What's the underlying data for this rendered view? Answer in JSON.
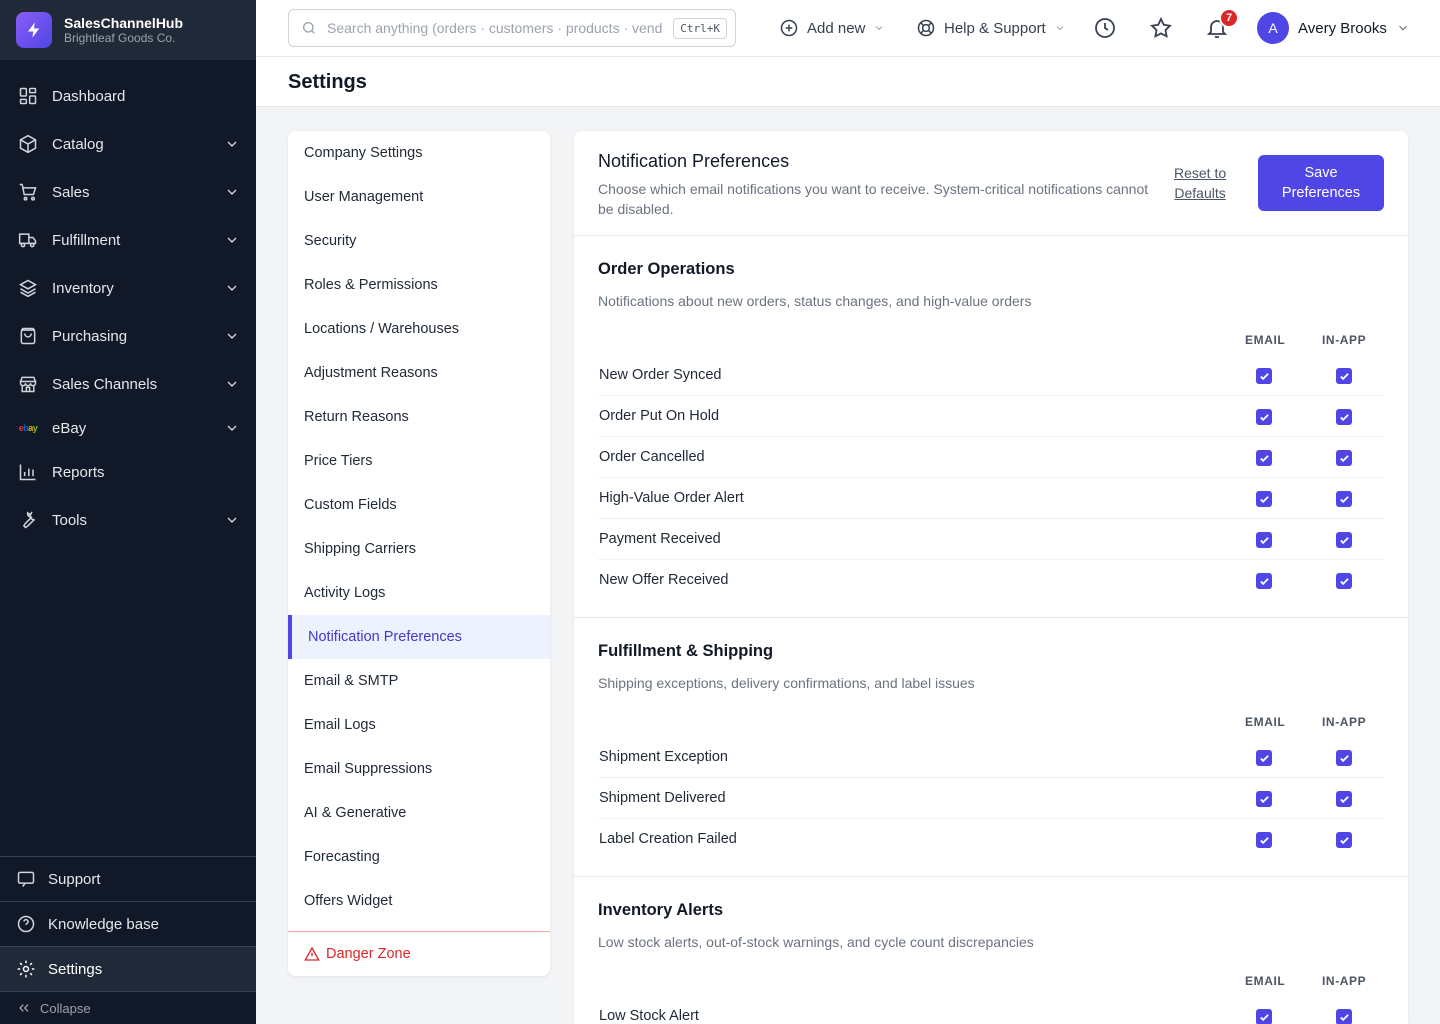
{
  "brand": {
    "name": "SalesChannelHub",
    "org": "Brightleaf Goods Co."
  },
  "nav": {
    "items": [
      {
        "label": "Dashboard",
        "icon": "dashboard-icon"
      },
      {
        "label": "Catalog",
        "icon": "box-icon"
      },
      {
        "label": "Sales",
        "icon": "cart-icon"
      },
      {
        "label": "Fulfillment",
        "icon": "truck-icon"
      },
      {
        "label": "Inventory",
        "icon": "layers-icon"
      },
      {
        "label": "Purchasing",
        "icon": "bag-icon"
      },
      {
        "label": "Sales Channels",
        "icon": "store-icon"
      },
      {
        "label": "eBay",
        "icon": "ebay-logo-icon"
      },
      {
        "label": "Reports",
        "icon": "bar-chart-icon"
      },
      {
        "label": "Tools",
        "icon": "wrench-icon"
      }
    ],
    "bottom": {
      "support": "Support",
      "knowledge": "Knowledge base",
      "settings": "Settings",
      "collapse": "Collapse"
    }
  },
  "topbar": {
    "search_placeholder": "Search anything (orders · customers · products · vendors)",
    "search_shortcut": "Ctrl+K",
    "add_new": "Add new",
    "help": "Help & Support",
    "notification_count": "7",
    "user_initial": "A",
    "user_name": "Avery Brooks"
  },
  "page": {
    "title": "Settings"
  },
  "settings_menu": {
    "items": [
      "Company Settings",
      "User Management",
      "Security",
      "Roles & Permissions",
      "Locations / Warehouses",
      "Adjustment Reasons",
      "Return Reasons",
      "Price Tiers",
      "Custom Fields",
      "Shipping Carriers",
      "Activity Logs",
      "Notification Preferences",
      "Email & SMTP",
      "Email Logs",
      "Email Suppressions",
      "AI & Generative",
      "Forecasting",
      "Offers Widget"
    ],
    "active": "Notification Preferences",
    "danger": "Danger Zone"
  },
  "panel": {
    "title": "Notification Preferences",
    "description": "Choose which email notifications you want to receive. System-critical notifications cannot be disabled.",
    "reset_label": "Reset to Defaults",
    "save_label": "Save Preferences",
    "col_email": "EMAIL",
    "col_inapp": "IN-APP",
    "sections": [
      {
        "title": "Order Operations",
        "description": "Notifications about new orders, status changes, and high-value orders",
        "rows": [
          {
            "label": "New Order Synced",
            "email": true,
            "inapp": true
          },
          {
            "label": "Order Put On Hold",
            "email": true,
            "inapp": true
          },
          {
            "label": "Order Cancelled",
            "email": true,
            "inapp": true
          },
          {
            "label": "High-Value Order Alert",
            "email": true,
            "inapp": true
          },
          {
            "label": "Payment Received",
            "email": true,
            "inapp": true
          },
          {
            "label": "New Offer Received",
            "email": true,
            "inapp": true
          }
        ]
      },
      {
        "title": "Fulfillment & Shipping",
        "description": "Shipping exceptions, delivery confirmations, and label issues",
        "rows": [
          {
            "label": "Shipment Exception",
            "email": true,
            "inapp": true
          },
          {
            "label": "Shipment Delivered",
            "email": true,
            "inapp": true
          },
          {
            "label": "Label Creation Failed",
            "email": true,
            "inapp": true
          }
        ]
      },
      {
        "title": "Inventory Alerts",
        "description": "Low stock alerts, out-of-stock warnings, and cycle count discrepancies",
        "rows": [
          {
            "label": "Low Stock Alert",
            "email": true,
            "inapp": true
          }
        ]
      }
    ]
  },
  "colors": {
    "accent": "#4f46e5",
    "sidebar": "#111827",
    "danger": "#dc2626"
  }
}
